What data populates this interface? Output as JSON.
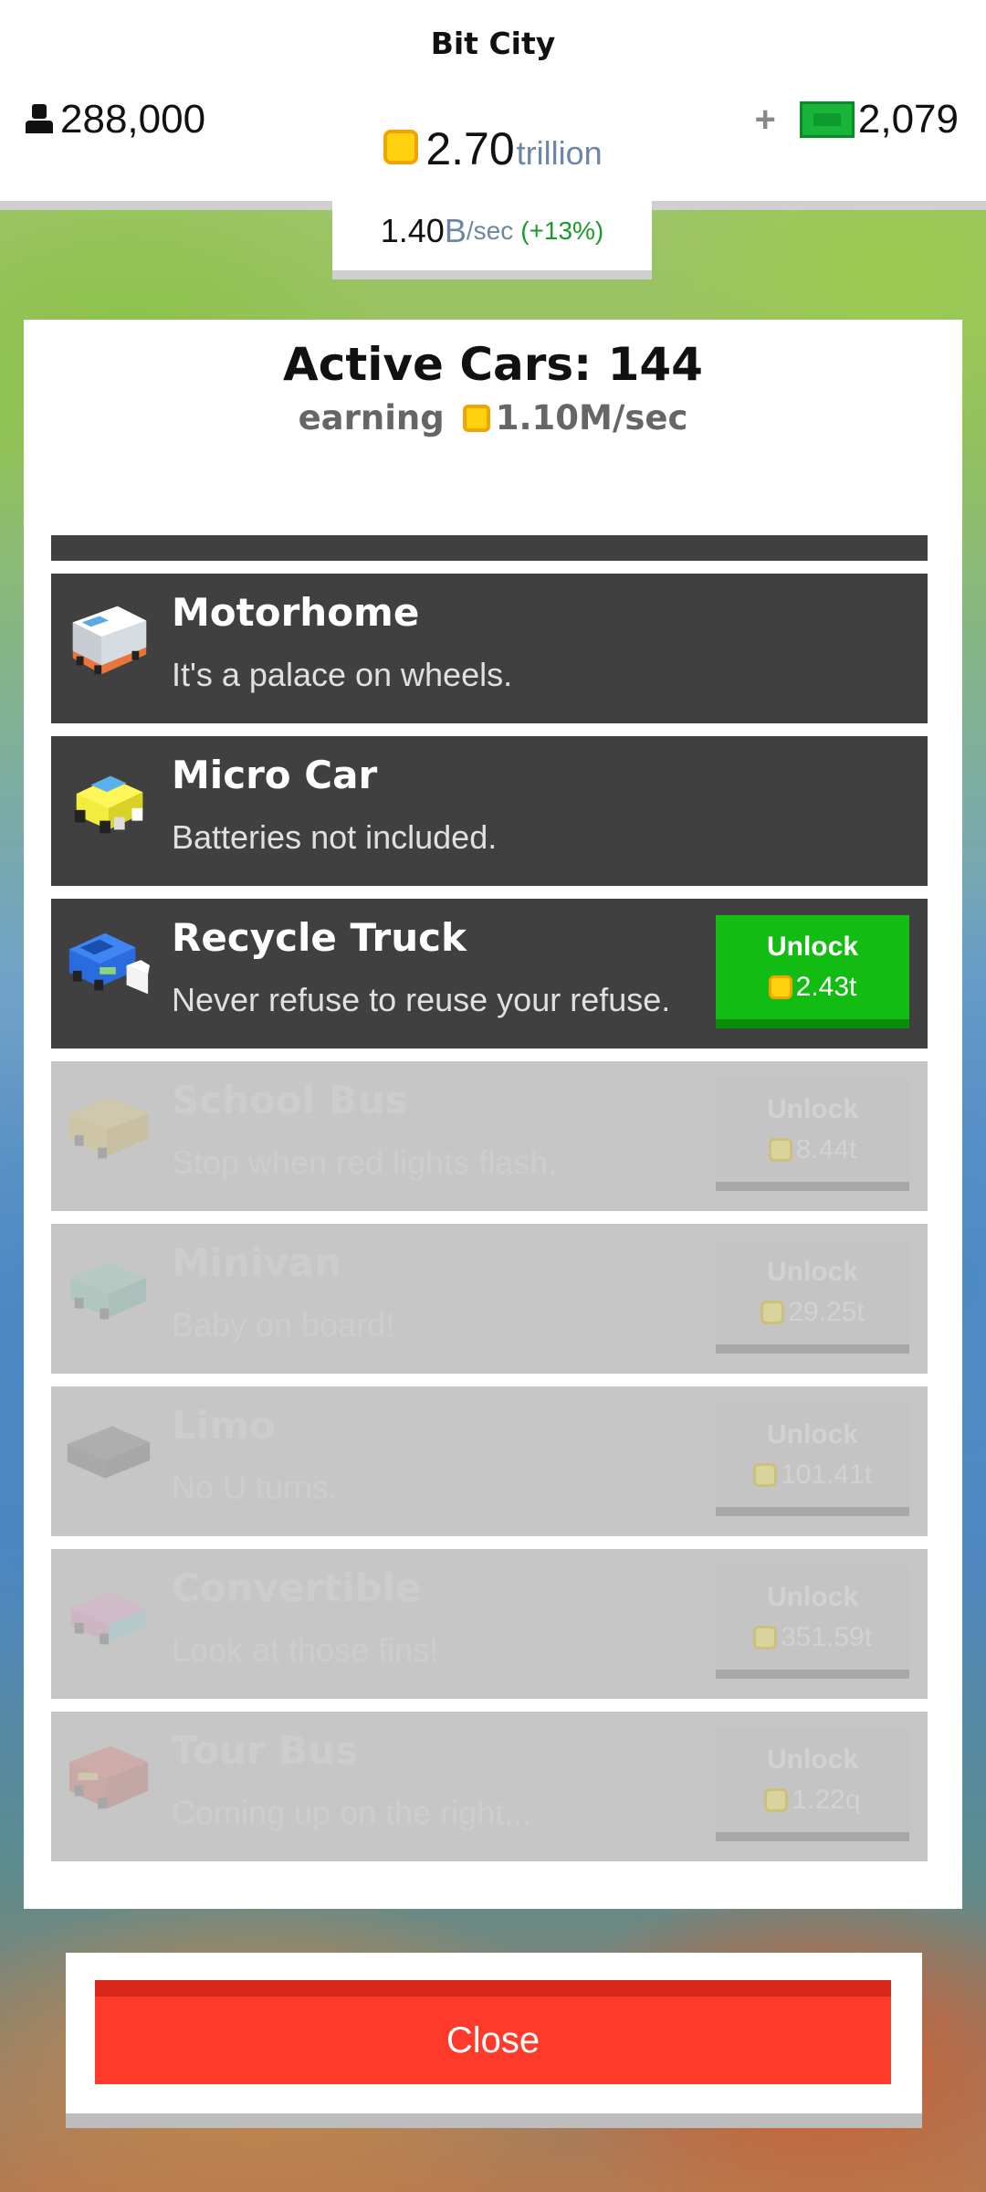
{
  "header": {
    "city_name": "Bit City",
    "population": "288,000",
    "coins_value": "2.70",
    "coins_unit": "trillion",
    "plus": "+",
    "bux": "2,079",
    "rate_value": "1.40",
    "rate_unit_b": "B",
    "rate_unit": "/sec",
    "rate_pct": "(+13%)"
  },
  "panel": {
    "title": "Active Cars: 144",
    "earning_label": "earning",
    "earning_value": "1.10M/sec"
  },
  "cars": [
    {
      "name": "Motorhome",
      "desc": "It's a palace on wheels.",
      "state": "owned",
      "icon": "motorhome-icon"
    },
    {
      "name": "Micro Car",
      "desc": "Batteries not included.",
      "state": "owned",
      "icon": "micro-car-icon"
    },
    {
      "name": "Recycle Truck",
      "desc": "Never refuse to reuse your refuse.",
      "state": "available",
      "button": "Unlock",
      "price": "2.43t",
      "icon": "recycle-truck-icon"
    },
    {
      "name": "School Bus",
      "desc": "Stop when red lights flash.",
      "state": "locked",
      "button": "Unlock",
      "price": "8.44t",
      "icon": "school-bus-icon"
    },
    {
      "name": "Minivan",
      "desc": "Baby on board!",
      "state": "locked",
      "button": "Unlock",
      "price": "29.25t",
      "icon": "minivan-icon"
    },
    {
      "name": "Limo",
      "desc": "No U turns.",
      "state": "locked",
      "button": "Unlock",
      "price": "101.41t",
      "icon": "limo-icon"
    },
    {
      "name": "Convertible",
      "desc": "Look at those fins!",
      "state": "locked",
      "button": "Unlock",
      "price": "351.59t",
      "icon": "convertible-icon"
    },
    {
      "name": "Tour Bus",
      "desc": "Coming up on the right...",
      "state": "locked",
      "button": "Unlock",
      "price": "1.22q",
      "icon": "tour-bus-icon"
    }
  ],
  "close_label": "Close",
  "colors": {
    "unlock_green": "#13bc13",
    "close_red": "#ff3a2a",
    "row_dark": "#404040",
    "row_locked": "#c6c6c6"
  }
}
